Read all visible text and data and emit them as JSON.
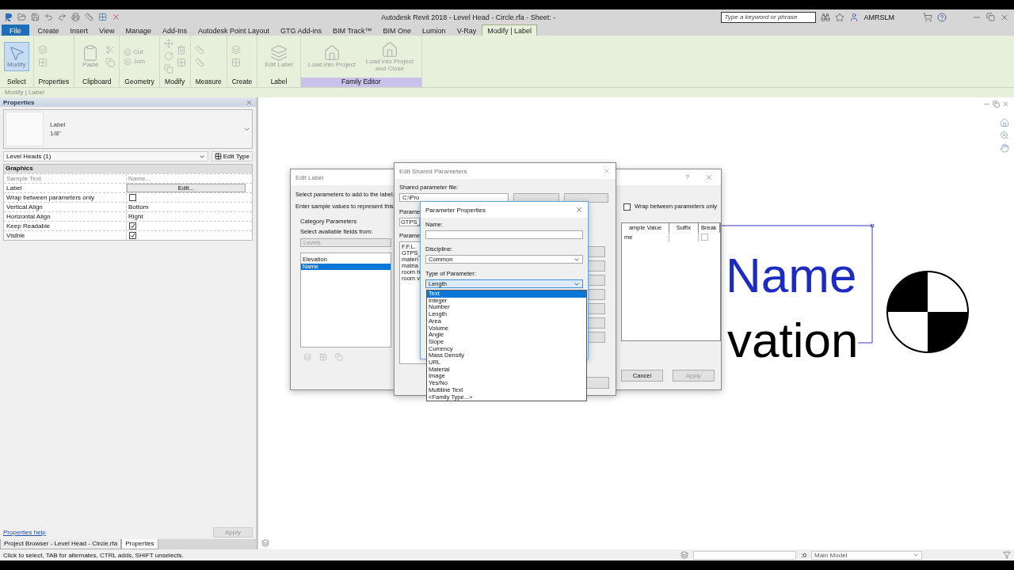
{
  "title_bar": {
    "title": "Autodesk Revit 2018 - Level Head - Circle.rfa - Sheet: -",
    "search": {
      "placeholder": "Type a keyword or phrase"
    },
    "user": "AMRSLM"
  },
  "menu_tabs": [
    {
      "label": "File",
      "kind": "file"
    },
    {
      "label": "Create",
      "kind": "tab",
      "selected": false
    },
    {
      "label": "Insert",
      "kind": "tab",
      "selected": false
    },
    {
      "label": "View",
      "kind": "tab",
      "selected": false
    },
    {
      "label": "Manage",
      "kind": "tab",
      "selected": false
    },
    {
      "label": "Add-Ins",
      "kind": "tab",
      "selected": false
    },
    {
      "label": "Autodesk Point Layout",
      "kind": "tab",
      "selected": false
    },
    {
      "label": "GTG Add-ins",
      "kind": "tab",
      "selected": false
    },
    {
      "label": "BIM Track™",
      "kind": "tab",
      "selected": false
    },
    {
      "label": "BIM One",
      "kind": "tab",
      "selected": false
    },
    {
      "label": "Lumion",
      "kind": "tab",
      "selected": false
    },
    {
      "label": "V-Ray",
      "kind": "tab",
      "selected": false
    },
    {
      "label": "Modify | Label",
      "kind": "tab",
      "selected": true
    }
  ],
  "ribbon": [
    {
      "label": "Select",
      "highlighted": false,
      "tools": [
        {
          "label": "Modify",
          "selected": true,
          "disabled": false
        }
      ]
    },
    {
      "label": "Properties",
      "highlighted": false
    },
    {
      "label": "Clipboard",
      "highlighted": false,
      "tools": [
        {
          "label": "Paste",
          "selected": false,
          "disabled": true
        }
      ]
    },
    {
      "label": "Geometry",
      "highlighted": false,
      "tools": [
        {
          "label": "Cut",
          "selected": false,
          "disabled": true
        },
        {
          "label": "Join",
          "selected": false,
          "disabled": true
        }
      ]
    },
    {
      "label": "Modify",
      "highlighted": false
    },
    {
      "label": "Measure",
      "highlighted": false
    },
    {
      "label": "Create",
      "highlighted": false
    },
    {
      "label": "Label",
      "highlighted": false,
      "tools": [
        {
          "label": "Edit Label",
          "selected": false,
          "disabled": true
        }
      ]
    },
    {
      "label": "Family Editor",
      "highlighted": true,
      "tools": [
        {
          "label": "Load into Project",
          "selected": false,
          "disabled": true
        },
        {
          "label": "Load into Project and Close",
          "selected": false,
          "disabled": true
        }
      ]
    }
  ],
  "options_bar": {
    "text": "Modify | Label"
  },
  "properties": {
    "title": "Properties",
    "type_name": "Label",
    "type_size": "1/8\"",
    "selector": "Level Heads (1)",
    "edit_type": "Edit Type",
    "group": "Graphics",
    "rows": [
      {
        "name": "Sample Text",
        "kind": "text",
        "value": "Name...",
        "disabled": true
      },
      {
        "name": "Label",
        "kind": "button",
        "value": "Edit...",
        "disabled": false
      },
      {
        "name": "Wrap between parameters only",
        "kind": "checkbox",
        "checked": false,
        "disabled": false
      },
      {
        "name": "Vertical Align",
        "kind": "text",
        "value": "Bottom",
        "disabled": false
      },
      {
        "name": "Horizontal Align",
        "kind": "text",
        "value": "Right",
        "disabled": false
      },
      {
        "name": "Keep Readable",
        "kind": "checkbox",
        "checked": true,
        "disabled": false
      },
      {
        "name": "Visible",
        "kind": "checkbox",
        "checked": true,
        "disabled": false
      }
    ],
    "help_link": "Properties help",
    "apply": "Apply"
  },
  "panel_tabs": [
    {
      "label": "Project Browser - Level Head - Circle.rfa",
      "selected": false
    },
    {
      "label": "Properties",
      "selected": true
    }
  ],
  "canvas": {
    "label_lines": [
      {
        "text": "Name",
        "selected": true
      },
      {
        "text": "vation",
        "selected": false
      }
    ]
  },
  "edit_label": {
    "title": "Edit Label",
    "help": "?",
    "intro": [
      "Select parameters to add to the label.",
      "Enter sample values to represent this"
    ],
    "group_title": "Category Parameters",
    "fields_from_label": "Select available fields from:",
    "category": "Levels",
    "fields": [
      {
        "label": "Elevation",
        "selected": false
      },
      {
        "label": "Name",
        "selected": true
      }
    ],
    "wrap": {
      "label": "Wrap between parameters only",
      "checked": false
    },
    "columns": [
      "ample Value",
      "Suffix",
      "Break"
    ],
    "rows": [
      {
        "sample_value": "me",
        "break": false
      }
    ],
    "buttons": [
      {
        "label": "Cancel",
        "disabled": false
      },
      {
        "label": "Apply",
        "disabled": true
      }
    ]
  },
  "shared_parameters": {
    "title": "Edit Shared Parameters",
    "file_label": "Shared parameter file:",
    "file_path": "C:\\Pro",
    "group_label": "Parame",
    "group": "GTPS_",
    "params_label": "Parame",
    "params": [
      "F.F.L.",
      "GTPS_",
      "materi",
      "matria",
      "room h",
      "room v"
    ]
  },
  "parameter_properties": {
    "title": "Parameter Properties",
    "name_label": "Name:",
    "discipline_label": "Discipline:",
    "discipline": "Common",
    "type_label": "Type of Parameter:",
    "type": "Length",
    "type_options": [
      {
        "label": "Text",
        "selected": true
      },
      {
        "label": "Integer",
        "selected": false
      },
      {
        "label": "Number",
        "selected": false
      },
      {
        "label": "Length",
        "selected": false
      },
      {
        "label": "Area",
        "selected": false
      },
      {
        "label": "Volume",
        "selected": false
      },
      {
        "label": "Angle",
        "selected": false
      },
      {
        "label": "Slope",
        "selected": false
      },
      {
        "label": "Currency",
        "selected": false
      },
      {
        "label": "Mass Density",
        "selected": false
      },
      {
        "label": "URL",
        "selected": false
      },
      {
        "label": "Material",
        "selected": false
      },
      {
        "label": "Image",
        "selected": false
      },
      {
        "label": "Yes/No",
        "selected": false
      },
      {
        "label": "Multiline Text",
        "selected": false
      },
      {
        "label": "<Family Type...>",
        "selected": false
      }
    ]
  },
  "status_bar": {
    "text": "Click to select, TAB for alternates, CTRL adds, SHIFT unselects.",
    "count": ":0",
    "model": "Main Model"
  }
}
